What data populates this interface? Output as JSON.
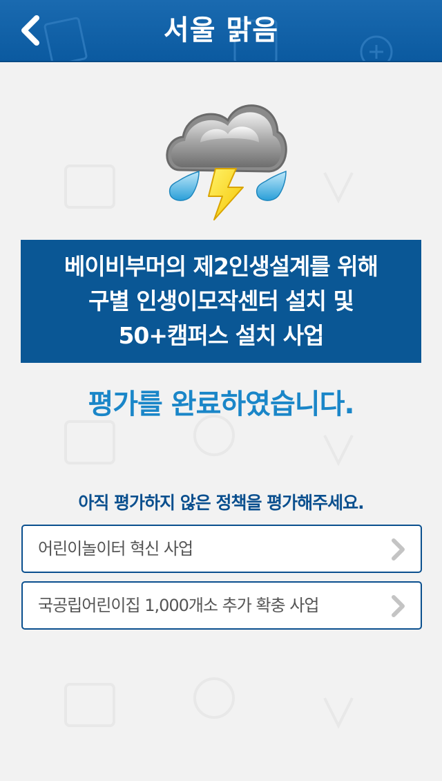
{
  "header": {
    "title": "서울 맑음",
    "back_icon": "chevron-left-icon"
  },
  "weather": {
    "icon": "thunderstorm-icon"
  },
  "policy": {
    "title_lines": [
      "베이비부머의 제2인생설계를 위해",
      "구별 인생이모작센터 설치 및",
      "50+캠퍼스 설치 사업"
    ]
  },
  "status": {
    "complete_message": "평가를 완료하였습니다.",
    "prompt_message": "아직 평가하지 않은 정책을 평가해주세요."
  },
  "remaining_policies": [
    {
      "label": "어린이놀이터 혁신 사업"
    },
    {
      "label": "국공립어린이집 1,000개소 추가 확충 사업"
    }
  ],
  "colors": {
    "header": "#0b5aa0",
    "policy_box": "#0a5795",
    "complete_text": "#1a86c8",
    "prompt_text": "#0a4f8e",
    "background": "#f2f2f2"
  }
}
